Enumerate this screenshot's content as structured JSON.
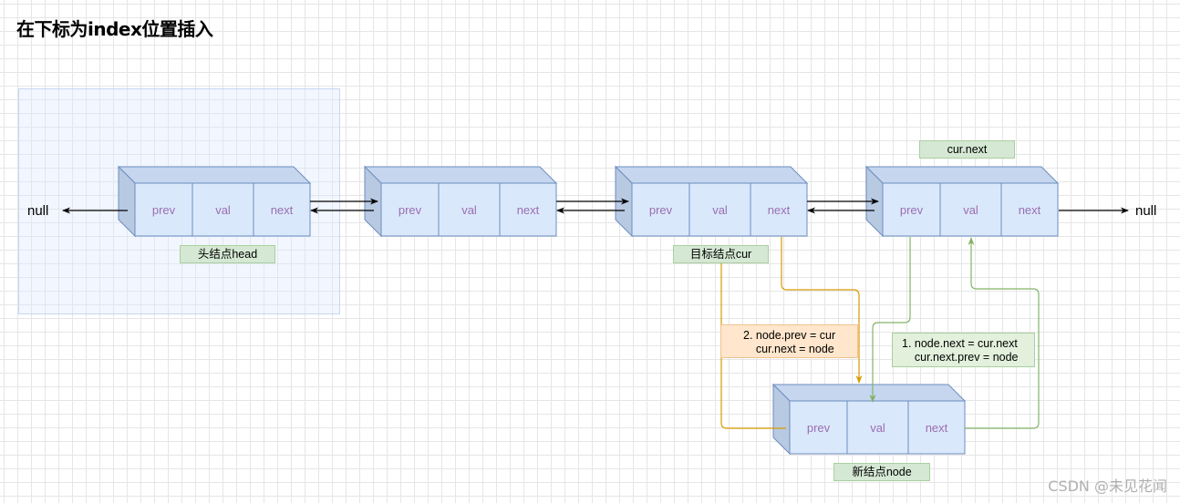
{
  "title": "在下标为index位置插入",
  "null_left": "null",
  "null_right": "null",
  "cells": {
    "prev": "prev",
    "val": "val",
    "next": "next"
  },
  "labels": {
    "head": "头结点head",
    "cur": "目标结点cur",
    "cur_next": "cur.next",
    "new_node": "新结点node"
  },
  "steps": {
    "step2": "2. node.prev = cur\n    cur.next = node",
    "step1": "1. node.next = cur.next\n    cur.next.prev = node"
  },
  "colors": {
    "node_fill": "#dae8fc",
    "node_stroke": "#6c8ebf",
    "orange_arrow": "#d79b00",
    "green_arrow": "#82b366"
  },
  "watermark": "CSDN @未见花闻"
}
